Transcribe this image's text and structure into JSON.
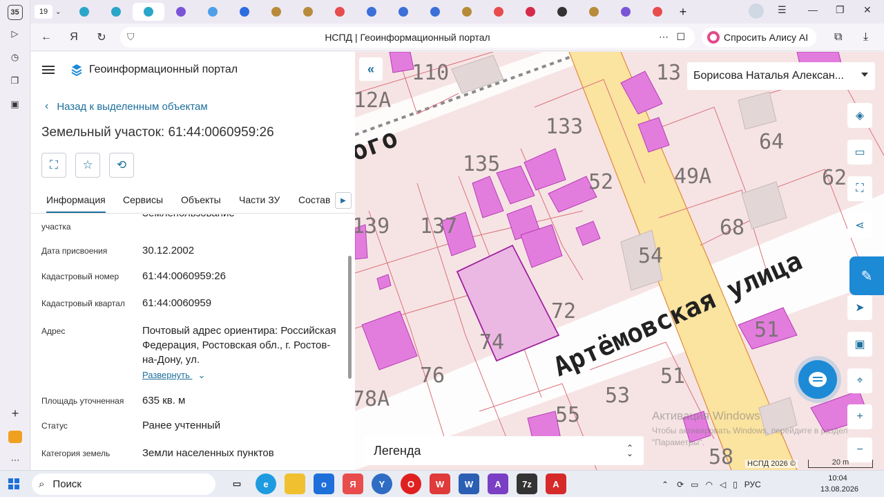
{
  "browser": {
    "rail_count": "35",
    "tab_count": "19",
    "active_tab_title": "НСПД | Геоинформационный портал",
    "alice_label": "Спросить Алису AI"
  },
  "portal": {
    "title": "Геоинформационный портал",
    "back_link": "Назад к выделенным объектам",
    "parcel_title": "Земельный участок: 61:44:0060959:26",
    "tabs": [
      "Информация",
      "Сервисы",
      "Объекты",
      "Части ЗУ",
      "Состав"
    ],
    "props": {
      "partial_label": "участка",
      "partial_value": "Землепользование",
      "date_label": "Дата присвоения",
      "date_value": "30.12.2002",
      "cad_num_label": "Кадастровый номер",
      "cad_num_value": "61:44:0060959:26",
      "cad_block_label": "Кадастровый квартал",
      "cad_block_value": "61:44:0060959",
      "address_label": "Адрес",
      "address_value": "Почтовый адрес ориентира: Российская Федерация, Ростовская обл., г. Ростов-на-Дону, ул.",
      "expand_label": "Развернуть",
      "area_label": "Площадь уточненная",
      "area_value": "635 кв. м",
      "status_label": "Статус",
      "status_value": "Ранее учтенный",
      "category_label": "Категория земель",
      "category_value": "Земли населенных пунктов"
    }
  },
  "map": {
    "user_name": "Борисова Наталья Алексан...",
    "legend_label": "Легенда",
    "watermark_title": "Активация Windows",
    "watermark_text": "Чтобы активировать Windows, перейдите в раздел \"Параметры\".",
    "copyright": "НСПД 2026 ©",
    "scale": "20 m",
    "street_name": "Артёмовская улица",
    "street_partial": "ого",
    "house_numbers": [
      "110",
      "12А",
      "133",
      "135",
      "64",
      "62",
      "49А",
      "52",
      "139",
      "137",
      "68",
      "54",
      "72",
      "74",
      "76",
      "51",
      "78А",
      "53",
      "55",
      "51",
      "58",
      "13"
    ]
  },
  "taskbar": {
    "search_label": "Поиск",
    "lang": "РУС",
    "time": "10:04",
    "date": "13.08.2026"
  },
  "colors": {
    "accent": "#1d6f9c",
    "parcel_fill": "#f4dede",
    "building_fill": "#e27ddd",
    "road_fill": "#fbe3a0"
  }
}
